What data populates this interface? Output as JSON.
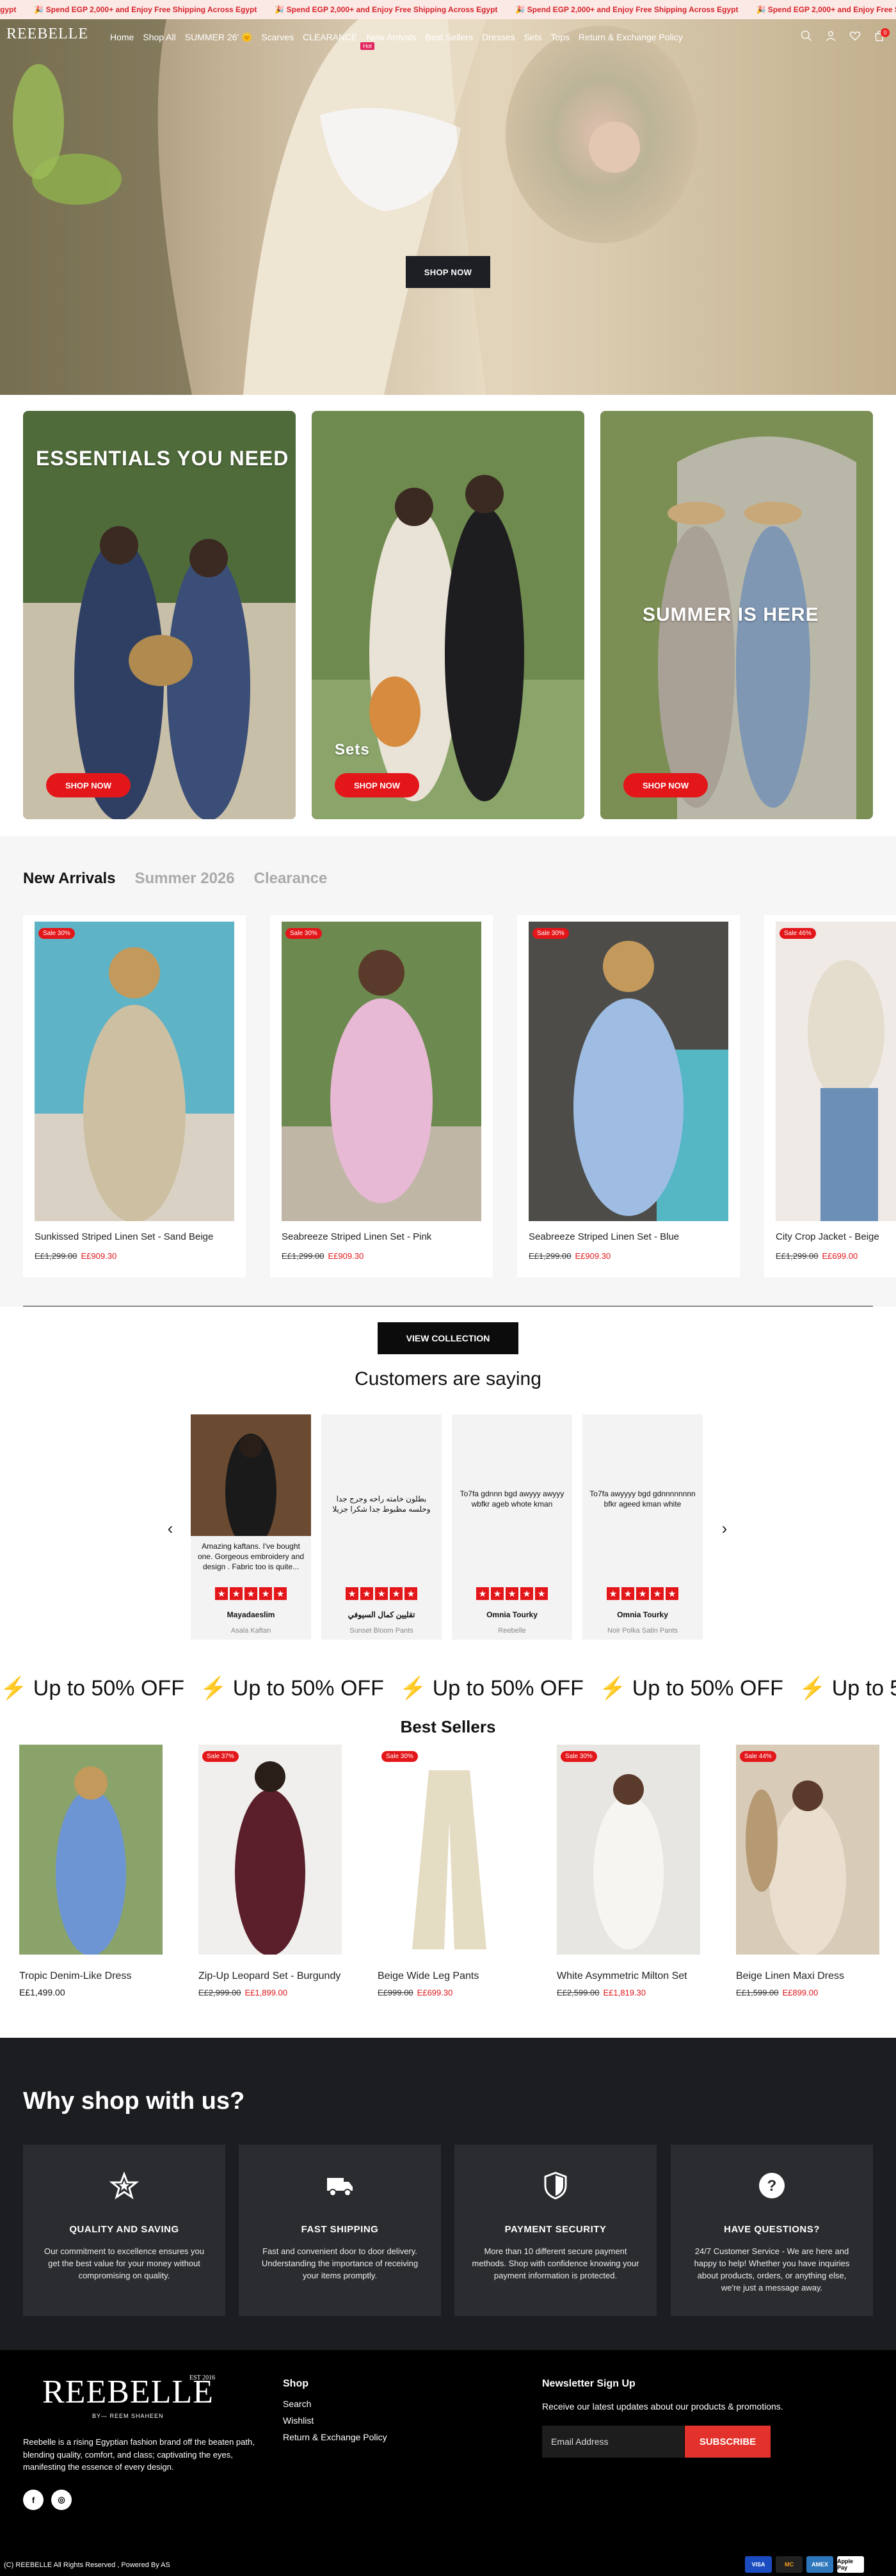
{
  "announcement": {
    "text": "🎉 Spend EGP 2,000+ and Enjoy Free Shipping Across Egypt",
    "prefix": "gypt"
  },
  "nav": {
    "logo": "REEBELLE",
    "items": [
      "Home",
      "Shop All",
      "SUMMER 26' 🌞",
      "Scarves",
      "CLEARANCE",
      "New Arrivals",
      "Best Sellers",
      "Dresses",
      "Sets",
      "Tops",
      "Return & Exchange Policy"
    ],
    "hot_badge": "Hot",
    "cart_count": "0"
  },
  "hero": {
    "button": "SHOP NOW"
  },
  "promos": [
    {
      "title": "ESSENTIALS YOU NEED",
      "button": "SHOP NOW"
    },
    {
      "title": "Sets",
      "button": "SHOP NOW"
    },
    {
      "title": "SUMMER IS HERE",
      "button": "SHOP NOW"
    }
  ],
  "arrivals": {
    "tabs": [
      "New Arrivals",
      "Summer 2026",
      "Clearance"
    ],
    "watermark": "Summer 2026",
    "products": [
      {
        "name": "Sunkissed Striped Linen Set - Sand Beige",
        "old": "E£1,299.00",
        "new": "E£909.30",
        "badge": "Sale 30%"
      },
      {
        "name": "Seabreeze Striped Linen Set - Pink",
        "old": "E£1,299.00",
        "new": "E£909.30",
        "badge": "Sale 30%"
      },
      {
        "name": "Seabreeze Striped Linen Set - Blue",
        "old": "E£1,299.00",
        "new": "E£909.30",
        "badge": "Sale 30%"
      },
      {
        "name": "City Crop Jacket - Beige",
        "old": "E£1,299.00",
        "new": "E£699.00",
        "badge": "Sale 46%"
      }
    ],
    "view_button": "VIEW COLLECTION"
  },
  "reviews": {
    "title": "Customers are saying",
    "items": [
      {
        "text": "Amazing kaftans. I've bought one. Gorgeous embroidery and design . Fabric too is quite...",
        "name": "Mayadaeslim",
        "product": "Asala Kaftan"
      },
      {
        "text": "بطلون خامته راحه وجرج جدا وحلسه مظبوط جدا شكرا جزيلا",
        "name": "تقليين كمال السيوفي",
        "product": "Sunset Bloom Pants"
      },
      {
        "text": "To7fa gdnnn bgd awyyy awyyy wbfkr ageb whote kman",
        "name": "Omnia Tourky",
        "product": "Reebelle"
      },
      {
        "text": "To7fa awyyyy bgd gdnnnnnnnn bfkr ageed kman white",
        "name": "Omnia Tourky",
        "product": "Noir Polka Satin Pants"
      }
    ]
  },
  "marquee": {
    "text": "⚡ Up to 50% OFF"
  },
  "bestsellers": {
    "title": "Best Sellers",
    "products": [
      {
        "name": "Tropic Denim-Like Dress",
        "price": "E£1,499.00",
        "old": "",
        "new": "",
        "badge": ""
      },
      {
        "name": "Zip-Up Leopard Set - Burgundy",
        "price": "",
        "old": "E£2,999.00",
        "new": "E£1,899.00",
        "badge": "Sale 37%"
      },
      {
        "name": "Beige Wide Leg Pants",
        "price": "",
        "old": "E£999.00",
        "new": "E£699.30",
        "badge": "Sale 30%"
      },
      {
        "name": "White Asymmetric Milton Set",
        "price": "",
        "old": "E£2,599.00",
        "new": "E£1,819.30",
        "badge": "Sale 30%"
      },
      {
        "name": "Beige Linen Maxi Dress",
        "price": "",
        "old": "E£1,599.00",
        "new": "E£899.00",
        "badge": "Sale 44%"
      }
    ]
  },
  "why": {
    "title": "Why shop with us?",
    "cards": [
      {
        "icon": "star-icon",
        "title": "QUALITY AND SAVING",
        "text": "Our commitment to excellence ensures you get the best value for your money without compromising on quality."
      },
      {
        "icon": "truck-icon",
        "title": "FAST SHIPPING",
        "text": "Fast and convenient door to door delivery. Understanding the importance of receiving your items promptly."
      },
      {
        "icon": "shield-icon",
        "title": "PAYMENT SECURITY",
        "text": "More than 10 different secure payment methods. Shop with confidence knowing your payment information is protected."
      },
      {
        "icon": "question-icon",
        "title": "HAVE QUESTIONS?",
        "text": "24/7 Customer Service - We are here and happy to help! Whether you have inquiries about products, orders, or anything else, we're just a message away."
      }
    ]
  },
  "footer": {
    "logo": "REEBELLE",
    "est": "EST  2016",
    "by": "BY— REEM SHAHEEN",
    "description": "Reebelle is a rising Egyptian fashion brand off the beaten path, blending quality, comfort, and class; captivating the eyes, manifesting the essence of every design.",
    "social": [
      "f",
      "◎"
    ],
    "shop_heading": "Shop",
    "shop_links": [
      "Search",
      "Wishlist",
      "Return & Exchange Policy"
    ],
    "newsletter_heading": "Newsletter Sign Up",
    "newsletter_text": "Receive our latest updates about our products & promotions.",
    "email_placeholder": "Email Address",
    "subscribe": "SUBSCRIBE",
    "copyright": "(C) REEBELLE All Rights Reserved , Powered By AS",
    "payments": [
      "VISA",
      "MC",
      "AMEX",
      "Apple Pay"
    ]
  },
  "colors": {
    "accent": "#e3161a",
    "dark": "#1c1d21",
    "ticker_bg": "#fbe9e6"
  }
}
